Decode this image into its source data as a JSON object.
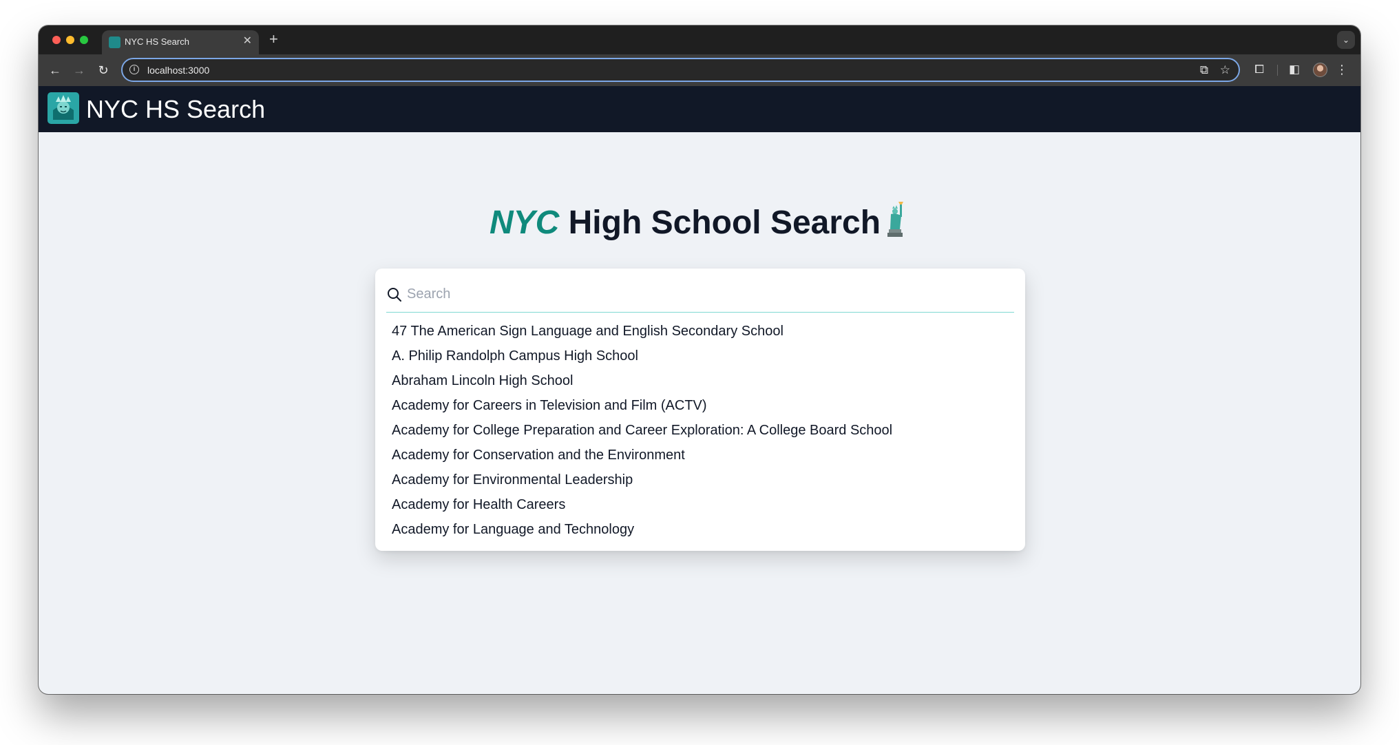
{
  "browser": {
    "tab_title": "NYC HS Search",
    "url": "localhost:3000"
  },
  "app": {
    "title": "NYC HS Search"
  },
  "hero": {
    "accent": "NYC",
    "rest": " High School Search"
  },
  "search": {
    "placeholder": "Search",
    "value": ""
  },
  "results": [
    "47 The American Sign Language and English Secondary School",
    "A. Philip Randolph Campus High School",
    "Abraham Lincoln High School",
    "Academy for Careers in Television and Film (ACTV)",
    "Academy for College Preparation and Career Exploration: A College Board School",
    "Academy for Conservation and the Environment",
    "Academy for Environmental Leadership",
    "Academy for Health Careers",
    "Academy for Language and Technology"
  ],
  "colors": {
    "accent": "#0f8a7c",
    "appbar": "#111827",
    "background": "#eff2f6"
  }
}
